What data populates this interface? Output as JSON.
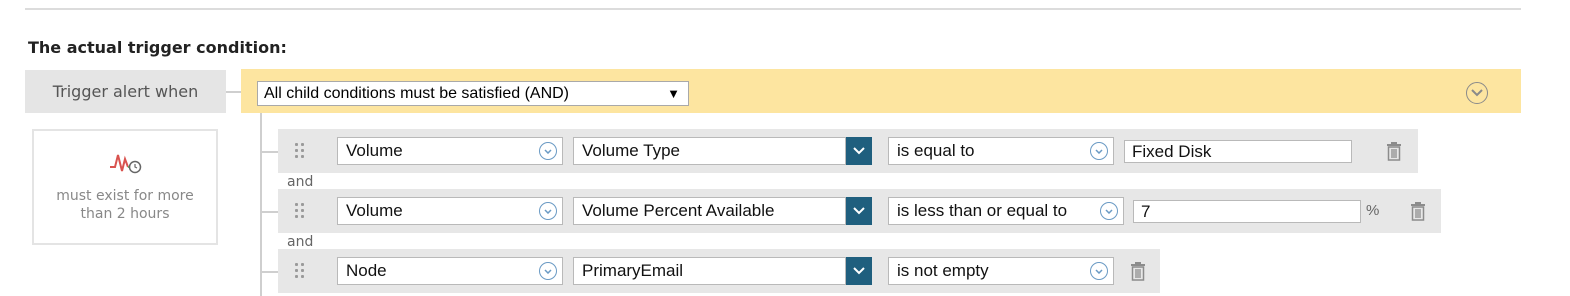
{
  "heading": "The actual trigger condition:",
  "trigger": {
    "label": "Trigger alert when",
    "group_operator": "All child conditions must be satisfied (AND)"
  },
  "duration": {
    "text_line1": "must exist for more",
    "text_line2": "than 2 hours"
  },
  "conjunction": "and",
  "conditions": [
    {
      "object": "Volume",
      "field": "Volume Type",
      "operator": "is equal to",
      "value": "Fixed Disk",
      "unit": ""
    },
    {
      "object": "Volume",
      "field": "Volume Percent Available",
      "operator": "is less than or equal to",
      "value": "7",
      "unit": "%"
    },
    {
      "object": "Node",
      "field": "PrimaryEmail",
      "operator": "is not empty",
      "value": "",
      "unit": ""
    }
  ],
  "colors": {
    "group_bar": "#fde5a0",
    "dropdown_button": "#1f5f7e",
    "chevron": "#6a9ac4"
  }
}
